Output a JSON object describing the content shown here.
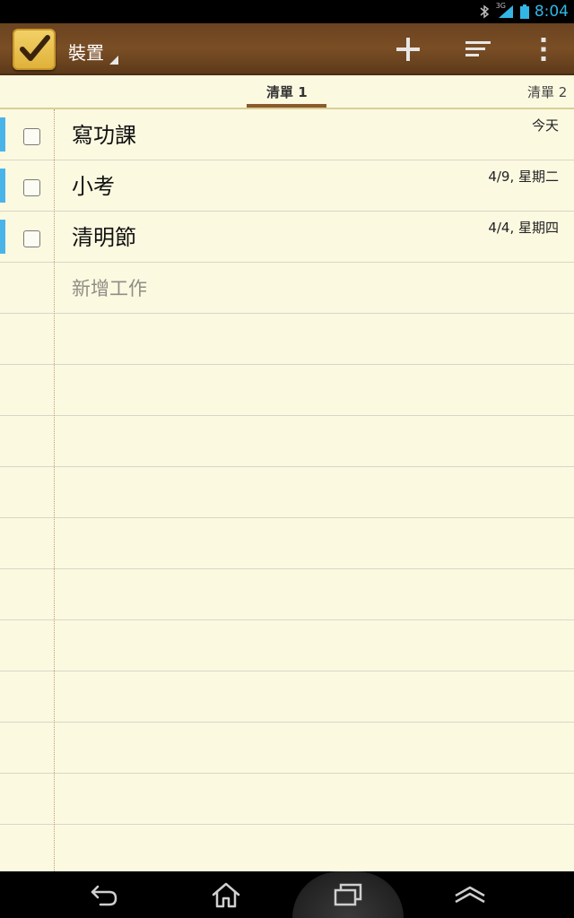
{
  "status_bar": {
    "clock": "8:04",
    "network_label": "3G",
    "icons": [
      "bluetooth-icon",
      "signal-icon",
      "battery-icon"
    ]
  },
  "action_bar": {
    "account_label": "裝置",
    "actions": [
      "add-icon",
      "sort-icon",
      "overflow-icon"
    ]
  },
  "tabs": [
    {
      "label": "清單 1",
      "selected": true
    },
    {
      "label": "清單 2",
      "selected": false
    }
  ],
  "tasks": [
    {
      "title": "寫功課",
      "date": "今天",
      "priority_color": "#4ab4e9",
      "checked": false
    },
    {
      "title": "小考",
      "date": "4/9, 星期二",
      "priority_color": "#4ab4e9",
      "checked": false
    },
    {
      "title": "清明節",
      "date": "4/4, 星期四",
      "priority_color": "#4ab4e9",
      "checked": false
    }
  ],
  "add_task_placeholder": "新增工作",
  "nav_bar": {
    "buttons": [
      "back-icon",
      "home-icon",
      "recent-apps-icon",
      "menu-icon"
    ]
  },
  "colors": {
    "action_bar": "#6a4320",
    "paper": "#fcf9e1",
    "accent": "#33b5e5",
    "tab_indicator": "#8a5a2c"
  }
}
